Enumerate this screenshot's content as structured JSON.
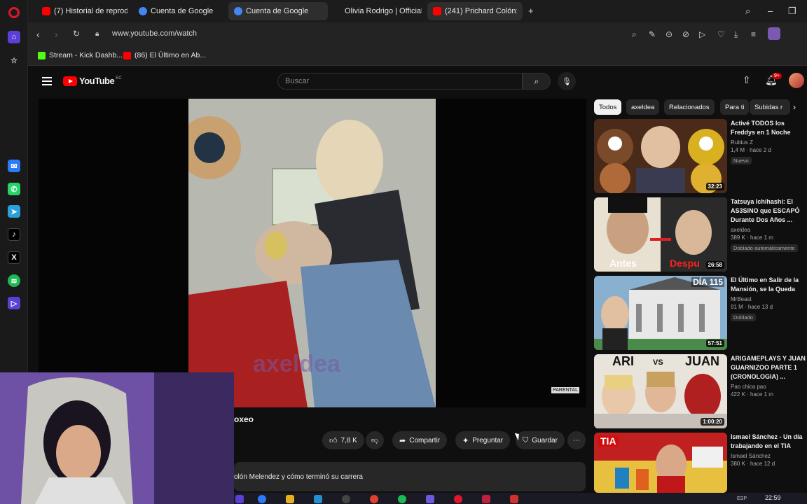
{
  "browser": {
    "tabs": [
      {
        "label": "(7) Historial de reproducc",
        "favicon": "youtube-icon",
        "color": "#ff0000"
      },
      {
        "label": "Cuenta de Google",
        "favicon": "google-icon",
        "color": "#4285f4"
      },
      {
        "label": "Cuenta de Google",
        "favicon": "google-icon",
        "color": "#4285f4"
      },
      {
        "label": "Olivia Rodrigo | Official Si",
        "favicon": "",
        "color": ""
      },
      {
        "label": "(241) Prichard Colón: l",
        "favicon": "youtube-icon",
        "color": "#ff0000"
      }
    ],
    "url": "www.youtube.com/watch",
    "bookmarks": [
      {
        "label": "Stream - Kick Dashb...",
        "color": "#53fc18"
      },
      {
        "label": "(86) El Último en Ab...",
        "color": "#ff0000"
      }
    ]
  },
  "youtube": {
    "logo_text": "YouTube",
    "country_code": "EC",
    "search_placeholder": "Buscar",
    "notification_count": "9+",
    "video": {
      "title": "oxeo",
      "watermark": "axeldea",
      "likes": "7,8 K",
      "share_label": "Compartir",
      "ask_label": "Preguntar",
      "save_label": "Guardar",
      "description": "olón Melendez y cómo terminó su carrera"
    },
    "chips": [
      {
        "label": "Todos",
        "active": true
      },
      {
        "label": "axeldea",
        "active": false
      },
      {
        "label": "Relacionados",
        "active": false
      },
      {
        "label": "Para ti",
        "active": false
      },
      {
        "label": "Subidas r",
        "active": false
      }
    ],
    "related": [
      {
        "title": "Activé TODOS los Freddys en 1 Noche",
        "channel": "Rubius Z",
        "meta": "1,4 M · hace 2 d",
        "tag": "Nuevo",
        "duration": "32:23",
        "thumb": "#3a2a1a"
      },
      {
        "title": "Tatsuya Ichihashi: El AS3SINO que ESCAPÓ Durante Dos Años ...",
        "channel": "axeldea",
        "meta": "389 K · hace 1 m",
        "tag": "Doblado automáticamente",
        "duration": "26:58",
        "thumb": "#2a2a2a",
        "overlay_left": "Antes",
        "overlay_right": "Despu"
      },
      {
        "title": "El Último en Salir de la Mansión, se la Queda",
        "channel": "MrBeast",
        "meta": "91 M · hace 13 d",
        "tag": "Doblado",
        "duration": "57:51",
        "thumb": "#5a7a9a",
        "overlay_top": "DÍA 115"
      },
      {
        "title": "ARIGAMEPLAYS Y JUAN GUARNIZOO PARTE 1 (CRONOLOGIA) ...",
        "channel": "Pao chica pao",
        "meta": "422 K · hace 1 m",
        "tag": "",
        "duration": "1:00:20",
        "thumb": "#d8d0c8",
        "overlay_left": "ARI",
        "overlay_vs": "VS",
        "overlay_right": "JUAN"
      },
      {
        "title": "Ismael Sánchez - Un día trabajando en el TIA",
        "channel": "Ismael Sánchez",
        "meta": "380 K · hace 12 d",
        "tag": "",
        "duration": "",
        "thumb": "#b82020",
        "overlay_left": "TIA"
      }
    ]
  },
  "taskbar": {
    "language": "ESP",
    "time": "22:59"
  }
}
